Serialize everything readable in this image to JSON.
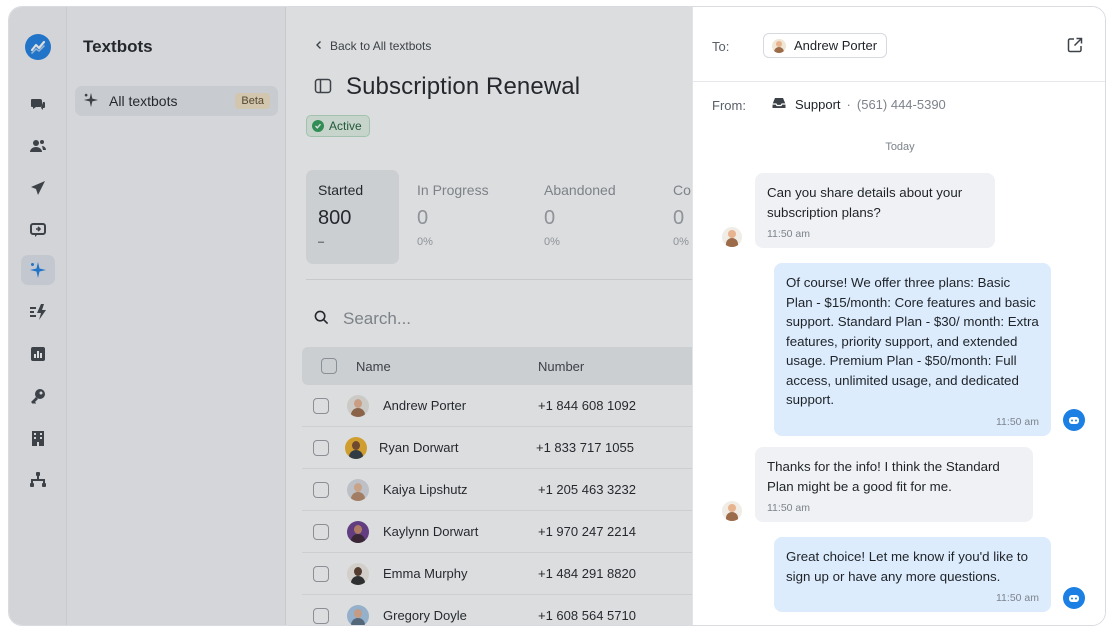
{
  "colors": {
    "accent": "#1c7fe3",
    "active_green": "#2f9e57",
    "beta_bg": "#f3e3c6"
  },
  "rail": {
    "icons": [
      "logo-icon",
      "chat-bubbles-icon",
      "contacts-icon",
      "send-icon",
      "reply-icon",
      "sparkle-icon",
      "automation-icon",
      "chart-icon",
      "key-icon",
      "building-icon",
      "hierarchy-icon"
    ],
    "active": "sparkle-icon"
  },
  "sidebar": {
    "title": "Textbots",
    "items": [
      {
        "label": "All textbots",
        "badge": "Beta",
        "icon": "sparkle-icon"
      }
    ]
  },
  "main": {
    "back_label": "Back to All textbots",
    "title": "Subscription Renewal",
    "status": "Active",
    "stats": [
      {
        "label": "Started",
        "value": "800",
        "sub": "–"
      },
      {
        "label": "In Progress",
        "value": "0",
        "sub": "0%"
      },
      {
        "label": "Abandoned",
        "value": "0",
        "sub": "0%"
      },
      {
        "label": "Co",
        "value": "0",
        "sub": "0%"
      }
    ],
    "search_placeholder": "Search...",
    "table": {
      "headers": [
        "Name",
        "Number"
      ],
      "rows": [
        {
          "name": "Andrew Porter",
          "number": "+1 844 608 1092"
        },
        {
          "name": "Ryan Dorwart",
          "number": "+1 833 717 1055"
        },
        {
          "name": "Kaiya Lipshutz",
          "number": "+1 205 463 3232"
        },
        {
          "name": "Kaylynn Dorwart",
          "number": "+1 970 247 2214"
        },
        {
          "name": "Emma Murphy",
          "number": "+1 484 291 8820"
        },
        {
          "name": "Gregory Doyle",
          "number": "+1 608 564 5710"
        }
      ]
    }
  },
  "conversation": {
    "to_label": "To:",
    "to_name": "Andrew Porter",
    "from_label": "From:",
    "from_name": "Support",
    "from_sep": "·",
    "from_phone": "(561) 444-5390",
    "day_label": "Today",
    "messages": [
      {
        "direction": "in",
        "text": "Can you share details about your subscription plans?",
        "time": "11:50 am"
      },
      {
        "direction": "out",
        "text": "Of course! We offer three plans: Basic Plan - $15/month: Core features and basic support. Standard Plan - $30/ month: Extra features, priority support, and extended usage. Premium Plan - $50/month: Full access, unlimited usage, and dedicated support.",
        "time": "11:50 am"
      },
      {
        "direction": "in",
        "text": "Thanks for the info! I think the Standard Plan might be a good fit for me.",
        "time": "11:50 am"
      },
      {
        "direction": "out",
        "text": "Great choice! Let me know if you'd like to sign up or have any more questions.",
        "time": "11:50 am"
      }
    ]
  }
}
